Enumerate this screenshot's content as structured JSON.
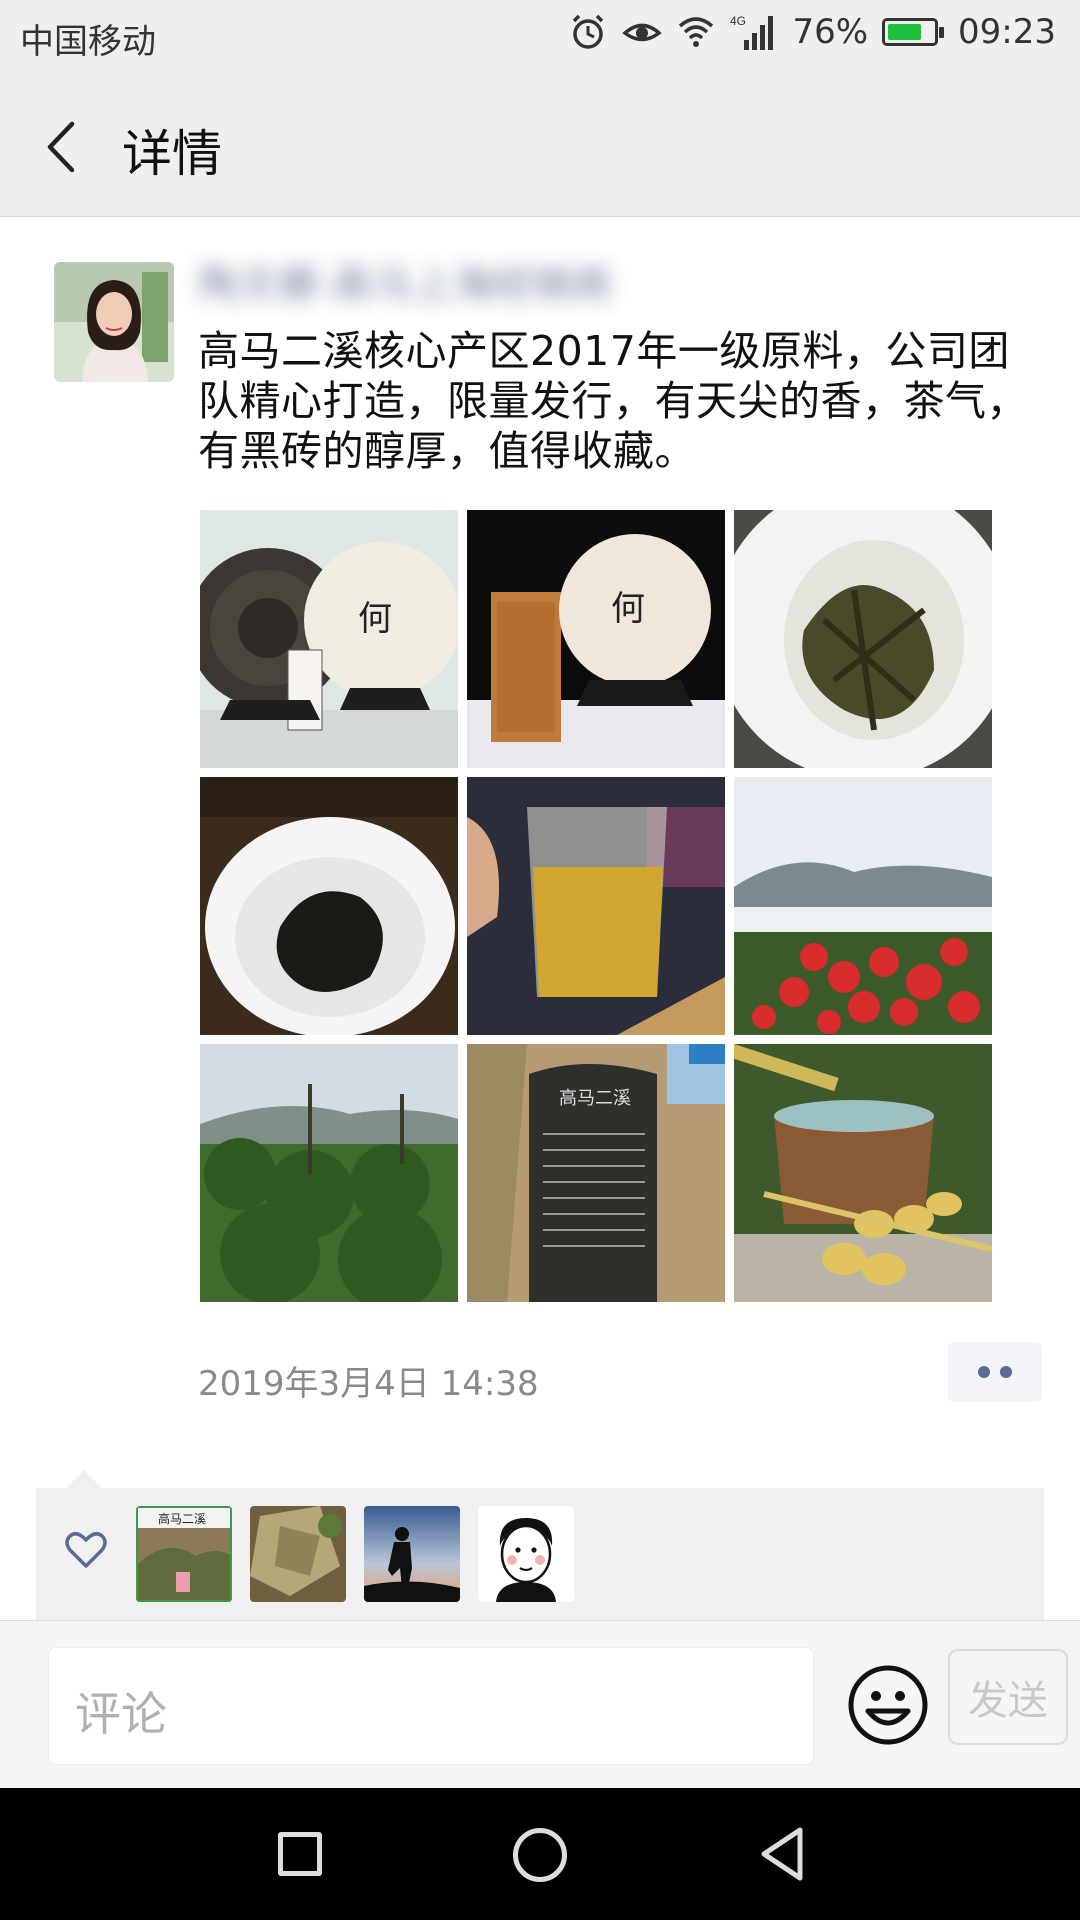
{
  "status_bar": {
    "carrier": "中国移动",
    "network": "4G",
    "battery_percent": "76%",
    "battery_level": 0.76,
    "time": "09:23",
    "icons": [
      "alarm-icon",
      "eye-icon",
      "wifi-icon",
      "signal-icon",
      "battery-icon"
    ]
  },
  "nav": {
    "title": "详情",
    "back_icon": "chevron-left-icon"
  },
  "post": {
    "author_name": "陶文娜-高马上海经销商",
    "text": "高马二溪核心产区2017年一级原料，公司团队精心打造，限量发行，有天尖的香，茶气，有黑砖的醇厚，值得收藏。",
    "time": "2019年3月4日 14:38",
    "photos": [
      {
        "name": "tea-cake-package-photo"
      },
      {
        "name": "tea-cake-tube-photo"
      },
      {
        "name": "tea-leaves-bowl-photo"
      },
      {
        "name": "dark-tea-bowl-photo"
      },
      {
        "name": "tea-glass-pitcher-photo"
      },
      {
        "name": "mountain-flowers-photo"
      },
      {
        "name": "forest-hills-photo"
      },
      {
        "name": "stone-stele-photo"
      },
      {
        "name": "bamboo-water-photo"
      }
    ],
    "stele_text": "高马二溪"
  },
  "likes": {
    "icon": "heart-icon",
    "avatars": [
      {
        "name": "like-avatar-1",
        "caption": "高马二溪"
      },
      {
        "name": "like-avatar-2"
      },
      {
        "name": "like-avatar-3"
      },
      {
        "name": "like-avatar-4"
      }
    ]
  },
  "comment_bar": {
    "placeholder": "评论",
    "emoji_icon": "smiley-icon",
    "send_label": "发送"
  },
  "colors": {
    "bar_bg": "#efefef",
    "link_blue": "#5b6b92",
    "battery_green": "#1fbf3b"
  }
}
